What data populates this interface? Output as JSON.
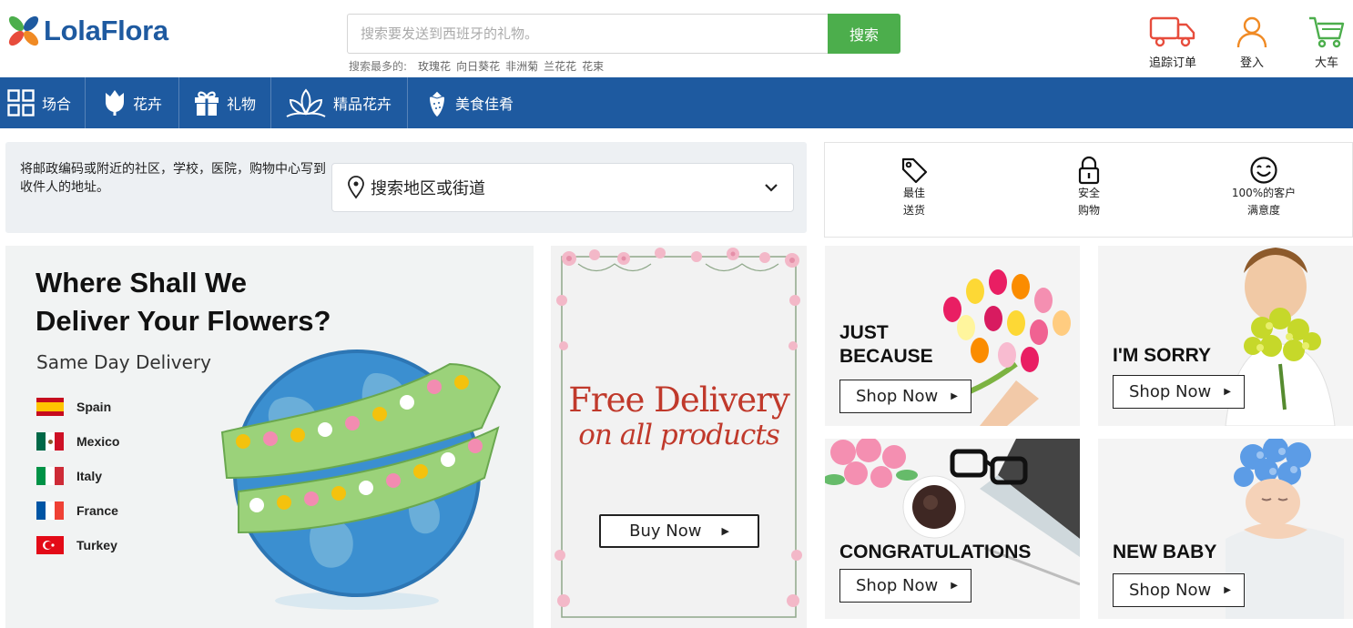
{
  "header": {
    "logo_text": "LolaFlora",
    "search_placeholder": "搜索要发送到西班牙的礼物。",
    "search_button": "搜索",
    "popular_label": "搜索最多的:",
    "popular_links": [
      "玫瑰花",
      "向日葵花",
      "非洲菊",
      "兰花花",
      "花束"
    ],
    "actions": [
      {
        "label": "追踪订单",
        "icon": "truck-icon"
      },
      {
        "label": "登入",
        "icon": "user-icon"
      },
      {
        "label": "大车",
        "icon": "cart-icon"
      }
    ]
  },
  "nav": {
    "items": [
      {
        "label": "场合",
        "icon": "grid-icon"
      },
      {
        "label": "花卉",
        "icon": "tulip-icon"
      },
      {
        "label": "礼物",
        "icon": "gift-icon"
      },
      {
        "label": "精品花卉",
        "icon": "lotus-icon"
      },
      {
        "label": "美食佳肴",
        "icon": "strawberry-icon"
      }
    ]
  },
  "address": {
    "hint": "将邮政编码或附近的社区，学校，医院，购物中心写到收件人的地址。",
    "select_label": "搜索地区或街道"
  },
  "trust_badges": [
    {
      "line1": "最佳",
      "line2": "送货",
      "icon": "tag-icon"
    },
    {
      "line1": "安全",
      "line2": "购物",
      "icon": "lock-icon"
    },
    {
      "line1": "100%的客户",
      "line2": "满意度",
      "icon": "smiley-icon"
    }
  ],
  "main_banner": {
    "title_line1": "Where Shall We",
    "title_line2": "Deliver Your Flowers?",
    "subtitle": "Same Day Delivery",
    "countries": [
      "Spain",
      "Mexico",
      "Italy",
      "France",
      "Turkey"
    ]
  },
  "free_banner": {
    "title": "Free Delivery",
    "subtitle": "on all products",
    "button": "Buy Now"
  },
  "tiles": [
    {
      "title_line1": "JUST",
      "title_line2": "BECAUSE",
      "button": "Shop Now"
    },
    {
      "title_line1": "I'M SORRY",
      "title_line2": "",
      "button": "Shop Now"
    },
    {
      "title_line1": "CONGRATULATIONS",
      "title_line2": "",
      "button": "Shop Now"
    },
    {
      "title_line1": "NEW BABY",
      "title_line2": "",
      "button": "Shop Now"
    }
  ],
  "colors": {
    "brand_blue": "#1e5aa0",
    "search_green": "#4cae4c",
    "accent_red": "#e74c3c",
    "accent_orange": "#f08a24",
    "accent_green": "#4cae4c"
  }
}
